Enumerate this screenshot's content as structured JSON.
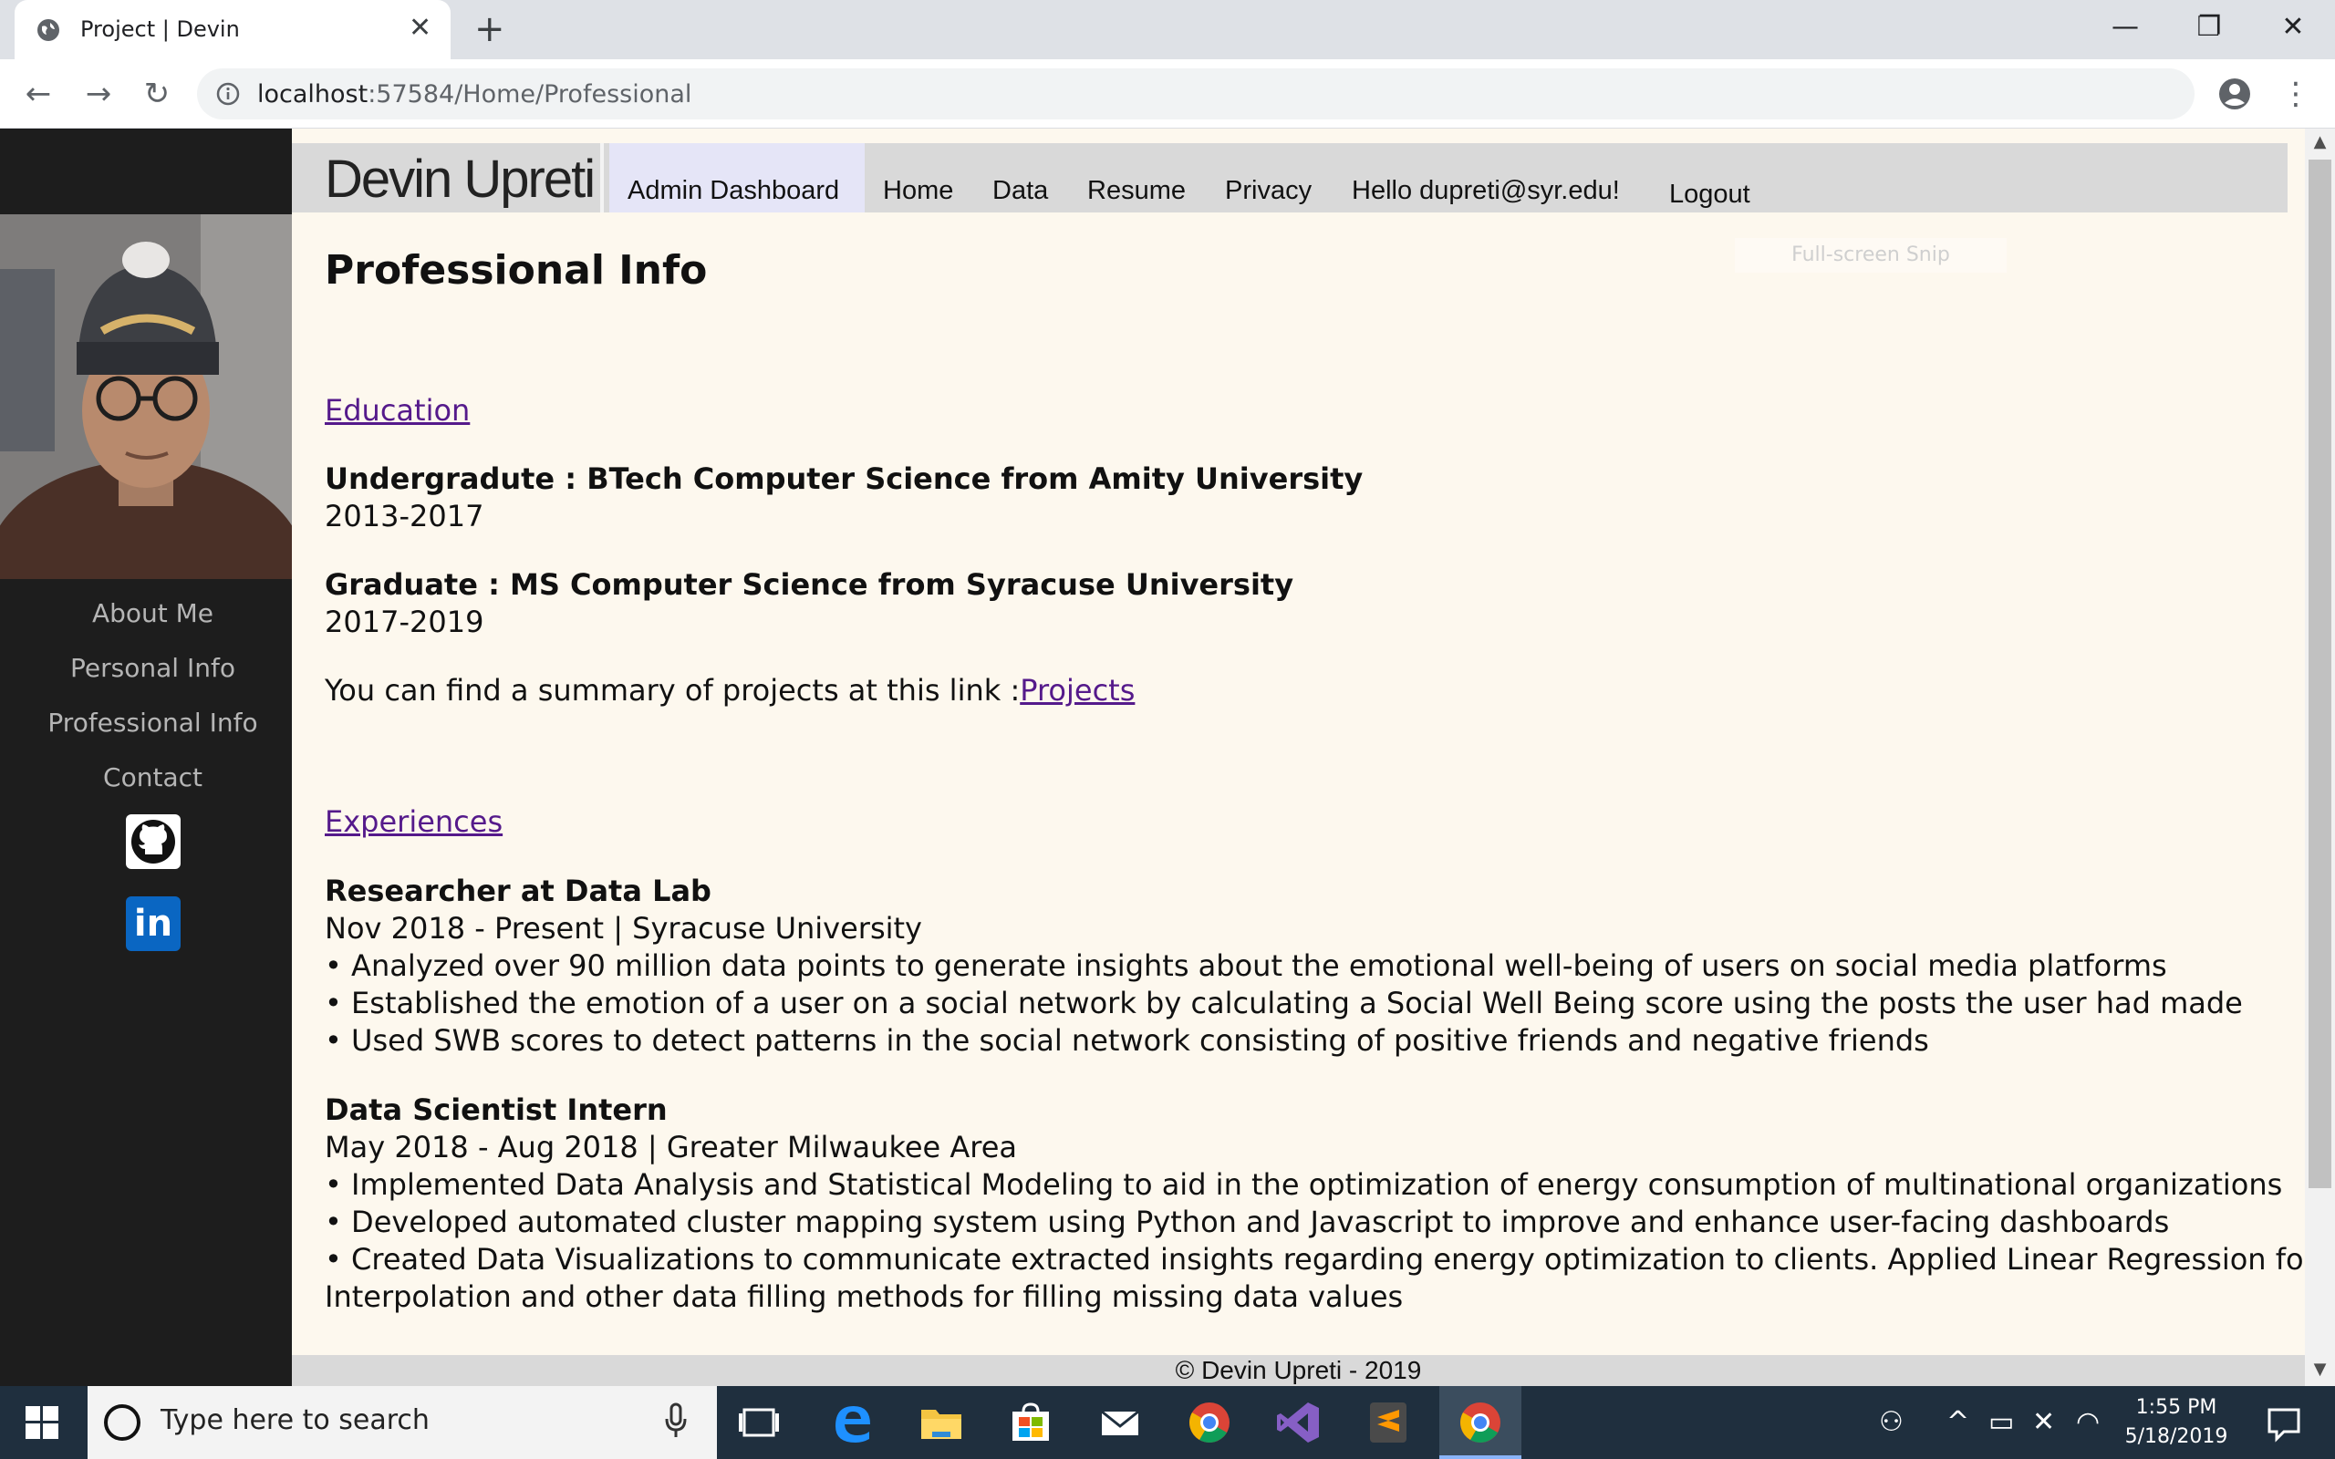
{
  "browser": {
    "tab_title": "Project | Devin",
    "tab_close": "✕",
    "new_tab": "+",
    "url_host": "localhost",
    "url_rest": ":57584/Home/Professional",
    "window_controls": {
      "minimize": "—",
      "restore": "❐",
      "close": "✕"
    },
    "nav": {
      "back": "←",
      "forward": "→",
      "reload": "↻"
    },
    "star": "☆",
    "menu": "⋮"
  },
  "sidebar": {
    "items": [
      {
        "label": "About Me"
      },
      {
        "label": "Personal Info"
      },
      {
        "label": "Professional Info"
      },
      {
        "label": "Contact"
      }
    ],
    "social": [
      "github-icon",
      "linkedin-icon"
    ],
    "linkedin_text": "in"
  },
  "navbar": {
    "brand": "Devin Upreti",
    "items": [
      {
        "label": "Admin Dashboard"
      },
      {
        "label": "Home"
      },
      {
        "label": "Data"
      },
      {
        "label": "Resume"
      },
      {
        "label": "Privacy"
      },
      {
        "label": "Hello dupreti@syr.edu!"
      },
      {
        "label": "Logout"
      }
    ]
  },
  "main": {
    "title": "Professional Info",
    "education_link": "Education",
    "education": [
      {
        "heading": "Undergradute : BTech Computer Science from Amity University",
        "years": "2013-2017"
      },
      {
        "heading": "Graduate : MS Computer Science from Syracuse University",
        "years": "2017-2019"
      }
    ],
    "projects_text": "You can find a summary of projects at this link :",
    "projects_link": "Projects",
    "experiences_link": "Experiences",
    "experiences": [
      {
        "title": "Researcher at Data Lab",
        "meta": "Nov 2018 - Present | Syracuse University",
        "bullets": [
          "• Analyzed over 90 million data points to generate insights about the emotional well-being of users on social media platforms",
          "• Established the emotion of a user on a social network by calculating a Social Well Being score using the posts the user had made",
          "• Used SWB scores to detect patterns in the social network consisting of positive friends and negative friends"
        ]
      },
      {
        "title": "Data Scientist Intern",
        "meta": "May 2018 - Aug 2018 | Greater Milwaukee Area",
        "bullets": [
          "• Implemented Data Analysis and Statistical Modeling to aid in the optimization of energy consumption of multinational organizations",
          "• Developed automated cluster mapping system using Python and Javascript to improve and enhance user-facing dashboards",
          "• Created Data Visualizations to communicate extracted insights regarding energy optimization to clients. Applied Linear Regression for",
          "Interpolation and other data filling methods for filling missing data values"
        ]
      }
    ],
    "footer": "© Devin Upreti - 2019",
    "snip_overlay": "Full-screen Snip"
  },
  "taskbar": {
    "search_placeholder": "Type here to search",
    "time": "1:55 PM",
    "date": "5/18/2019"
  },
  "colors": {
    "sidebar_bg": "#1d1d1d",
    "page_bg": "#fdf8ee",
    "navbar_bg": "#d9d9d9",
    "link": "#551a8b",
    "taskbar_bg": "#1f2f3e"
  }
}
